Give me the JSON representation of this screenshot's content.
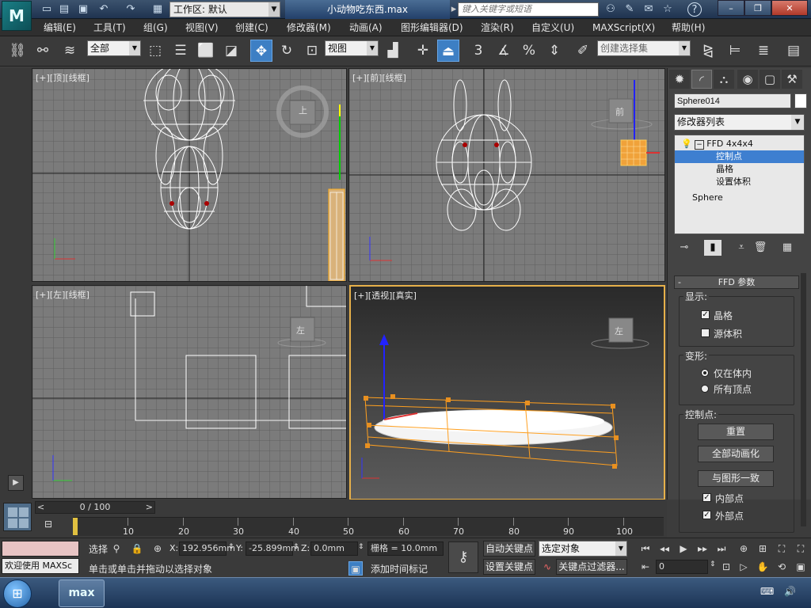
{
  "titlebar": {
    "logo_text": "M",
    "workspace_label": "工作区: 默认",
    "doc_title": "小动物吃东西.max",
    "search_placeholder": "键入关键字或短语",
    "window_buttons": {
      "minimize": "–",
      "restore": "❐",
      "close": "✕"
    }
  },
  "menu": {
    "items": [
      "编辑(E)",
      "工具(T)",
      "组(G)",
      "视图(V)",
      "创建(C)",
      "修改器(M)",
      "动画(A)",
      "图形编辑器(D)",
      "渲染(R)",
      "自定义(U)",
      "MAXScript(X)",
      "帮助(H)"
    ]
  },
  "toolbar": {
    "selection_filter": "全部",
    "ref_coord": "视图",
    "named_selection_placeholder": "创建选择集",
    "snap_label": "3"
  },
  "viewports": {
    "top": {
      "label": "[+][顶][线框]",
      "viewcube": "上"
    },
    "front": {
      "label": "[+][前][线框]",
      "viewcube": "前"
    },
    "left": {
      "label": "[+][左][线框]",
      "viewcube": "左"
    },
    "perspective": {
      "label": "[+][透视][真实]",
      "viewcube": "左"
    }
  },
  "command_panel": {
    "object_name": "Sphere014",
    "modifier_list": "修改器列表",
    "stack": {
      "modifier": "FFD 4x4x4",
      "sub_items": [
        "控制点",
        "晶格",
        "设置体积"
      ],
      "selected_sub": "控制点",
      "base": "Sphere"
    },
    "rollout_title": "FFD 参数",
    "display_group": "显示:",
    "display_lattice": "晶格",
    "display_source_volume": "源体积",
    "deform_group": "变形:",
    "deform_inside": "仅在体内",
    "deform_all": "所有顶点",
    "cp_group": "控制点:",
    "btn_reset": "重置",
    "btn_animate_all": "全部动画化",
    "btn_conform": "与图形一致",
    "cb_inside": "内部点",
    "cb_outside": "外部点"
  },
  "timeline": {
    "slider": "0 / 100",
    "ticks": [
      "10",
      "20",
      "30",
      "40",
      "50",
      "60",
      "70",
      "80",
      "90",
      "100"
    ]
  },
  "status": {
    "maxscript_label": "欢迎使用 MAXSc",
    "select_label": "选择",
    "x_label": "X:",
    "x_value": "192.956mm",
    "y_label": "Y:",
    "y_value": "-25.899mm",
    "z_label": "Z:",
    "z_value": "0.0mm",
    "grid_label": "栅格 = 10.0mm",
    "prompt": "单击或单击并拖动以选择对象",
    "add_time_tag": "添加时间标记",
    "auto_key": "自动关键点",
    "set_key": "设置关键点",
    "key_mode": "选定对象",
    "key_filters": "关键点过滤器...",
    "frame_value": "0"
  },
  "taskbar": {
    "app_label": "max"
  }
}
